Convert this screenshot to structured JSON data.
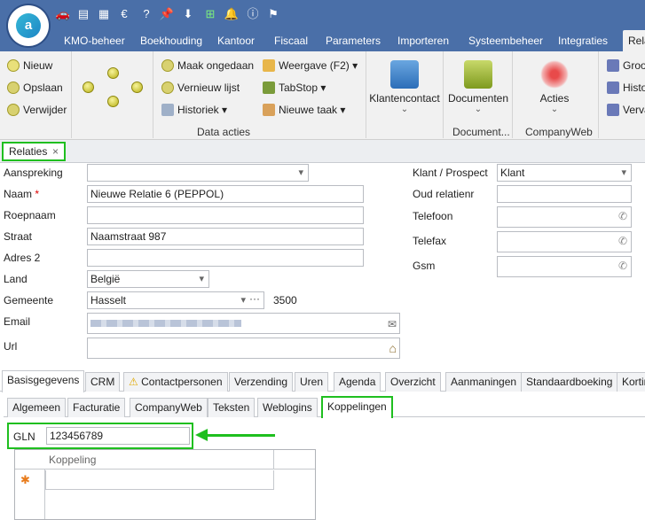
{
  "titlebar": {
    "logo_letter": "a",
    "quick_access_icons": [
      "car-icon",
      "contacts-icon",
      "calculator-icon",
      "currency-icon",
      "help-icon",
      "pin-icon",
      "download-icon",
      "add-icon",
      "bell-icon",
      "info-icon",
      "flag-icon"
    ]
  },
  "menu": {
    "tabs": [
      "KMO-beheer",
      "Boekhouding",
      "Kantoor",
      "Fiscaal",
      "Parameters",
      "Importeren",
      "Systeembeheer",
      "Integraties",
      "Rela"
    ]
  },
  "ribbon": {
    "new": "Nieuw",
    "save": "Opslaan",
    "delete": "Verwijder",
    "undo": "Maak ongedaan",
    "refresh": "Vernieuw lijst",
    "history": "Historiek",
    "view": "Weergave (F2)",
    "tabstop": "TabStop",
    "new_task": "Nieuwe taak",
    "group_data": "Data acties",
    "klantencontact": "Klantencontact",
    "documenten": "Documenten",
    "group_documents": "Document...",
    "acties": "Acties",
    "group_companyweb": "CompanyWeb",
    "right_items": [
      "Groo",
      "Histo",
      "Verva"
    ]
  },
  "doc_tab": {
    "label": "Relaties",
    "close": "×"
  },
  "form": {
    "left": [
      {
        "label": "Aanspreking",
        "value": ""
      },
      {
        "label": "Naam",
        "value": "Nieuwe Relatie 6 (PEPPOL)",
        "required": "*"
      },
      {
        "label": "Roepnaam",
        "value": ""
      },
      {
        "label": "Straat",
        "value": "Naamstraat 987"
      },
      {
        "label": "Adres 2",
        "value": ""
      },
      {
        "label": "Land",
        "value": "België"
      },
      {
        "label": "Gemeente",
        "value": "Hasselt"
      },
      {
        "label": "Email",
        "value": ""
      },
      {
        "label": "Url",
        "value": ""
      }
    ],
    "postcode": "3500",
    "right": [
      {
        "label": "Klant / Prospect",
        "value": "Klant"
      },
      {
        "label": "Oud relatienr",
        "value": ""
      },
      {
        "label": "Telefoon",
        "value": ""
      },
      {
        "label": "Telefax",
        "value": ""
      },
      {
        "label": "Gsm",
        "value": ""
      }
    ]
  },
  "tabs_main": [
    "Basisgegevens",
    "CRM",
    "Contactpersonen",
    "Verzending",
    "Uren",
    "Agenda",
    "Overzicht",
    "Aanmaningen",
    "Standaardboeking",
    "Kortin"
  ],
  "tabs_sub": [
    "Algemeen",
    "Facturatie",
    "CompanyWeb",
    "Teksten",
    "Weblogins",
    "Koppelingen"
  ],
  "gln": {
    "label": "GLN",
    "value": "123456789"
  },
  "grid": {
    "column": "Koppeling",
    "new_row_marker": "✱"
  },
  "colors": {
    "accent_green": "#1fbf1f",
    "titlebar_blue": "#4a6fa8"
  }
}
